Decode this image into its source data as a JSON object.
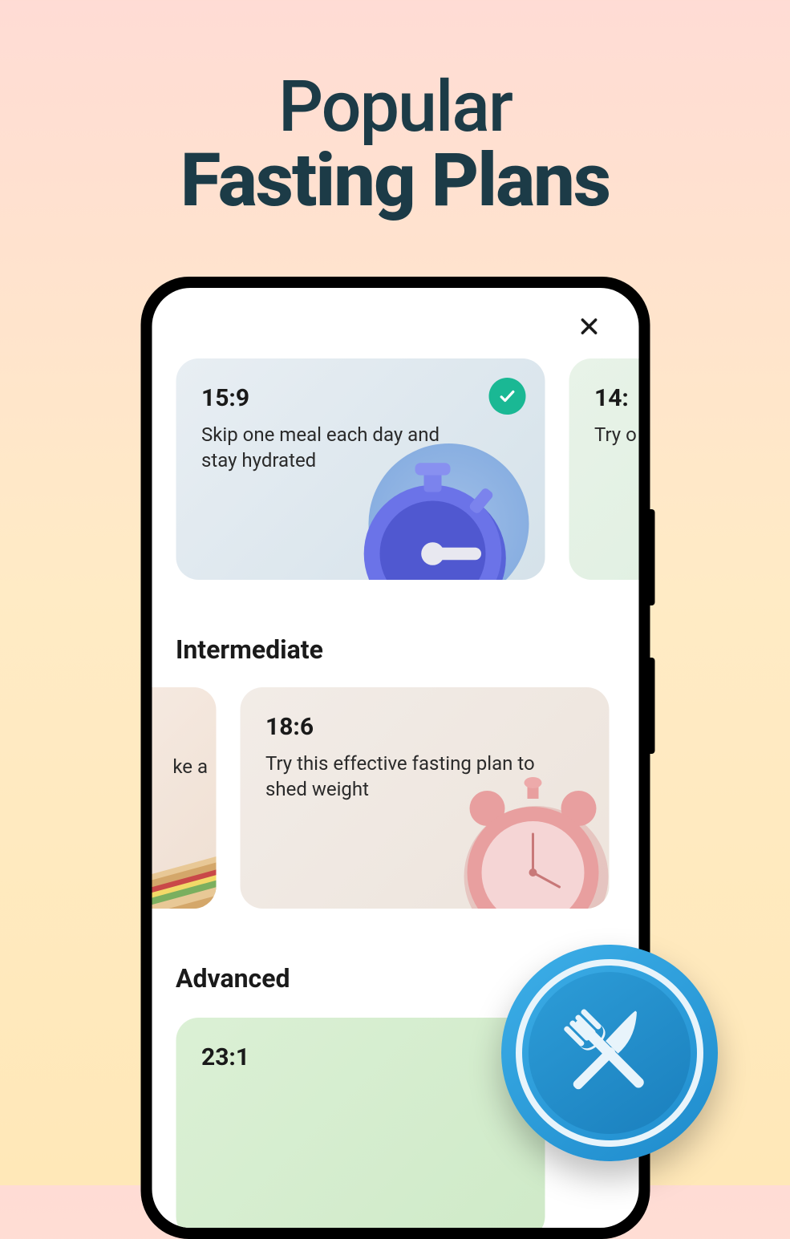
{
  "hero": {
    "line1": "Popular",
    "line2": "Fasting Plans"
  },
  "sections": {
    "intermediate": "Intermediate",
    "advanced": "Advanced"
  },
  "cards": {
    "card159": {
      "ratio": "15:9",
      "desc": "Skip one meal each day and stay hydrated",
      "selected": true
    },
    "card1410": {
      "ratio": "14:",
      "desc": "Try o your"
    },
    "cardPartial": {
      "text": "ke a"
    },
    "card186": {
      "ratio": "18:6",
      "desc": "Try this effective fasting plan to shed weight"
    },
    "card231": {
      "ratio": "23:1"
    }
  },
  "icons": {
    "close": "close-icon",
    "check": "check-icon",
    "stopwatch": "stopwatch-icon",
    "clock": "alarm-clock-icon",
    "sandwich": "sandwich-icon",
    "forkKnife": "fork-knife-icon"
  }
}
